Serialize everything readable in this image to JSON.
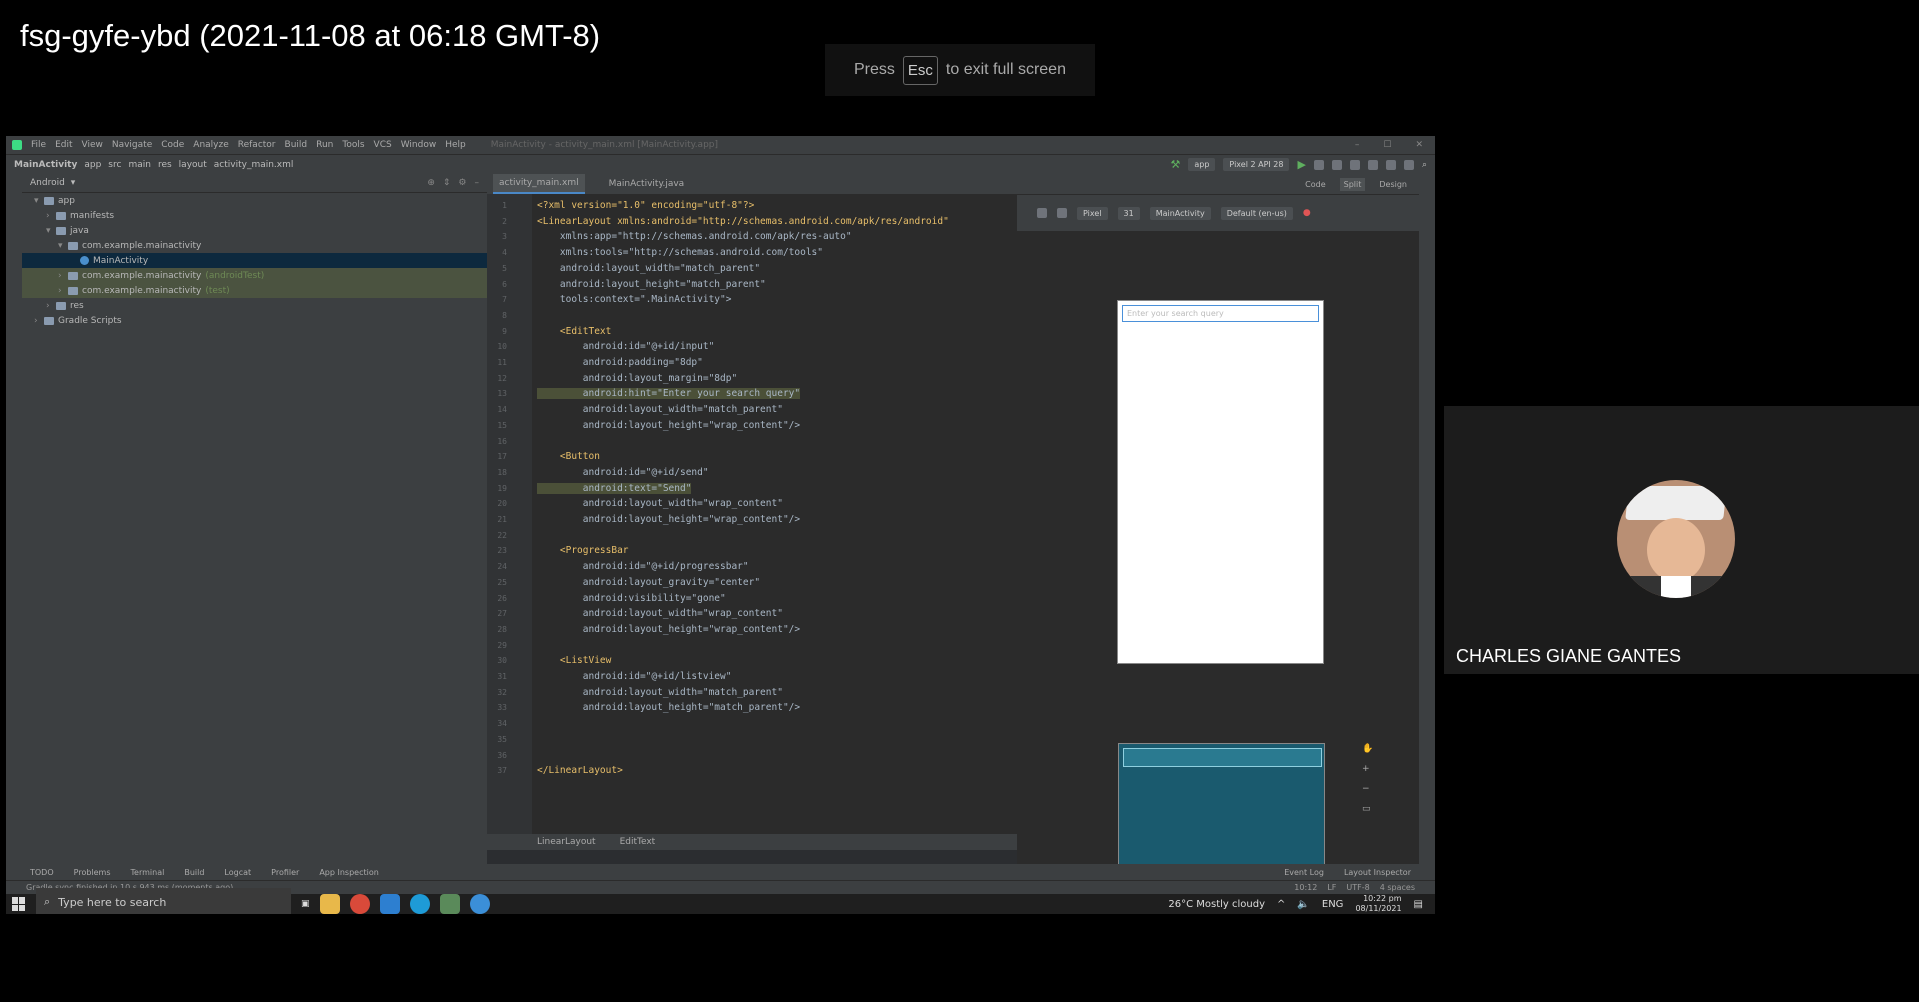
{
  "meeting": {
    "title": "fsg-gyfe-ybd (2021-11-08 at 06:18 GMT-8)",
    "esc_hint_press": "Press",
    "esc_key": "Esc",
    "esc_hint_rest": "to exit full screen"
  },
  "ide": {
    "menu": [
      "File",
      "Edit",
      "View",
      "Navigate",
      "Code",
      "Analyze",
      "Refactor",
      "Build",
      "Run",
      "Tools",
      "VCS",
      "Window",
      "Help"
    ],
    "window_title": "MainActivity - activity_main.xml [MainActivity.app]",
    "breadcrumbs": [
      "MainActivity",
      "app",
      "src",
      "main",
      "res",
      "layout",
      "activity_main.xml"
    ],
    "run_config": "app",
    "device": "Pixel 2 API 28",
    "project_view": "Android",
    "tree": [
      {
        "label": "app",
        "indent": 1,
        "arrow": "▾",
        "suffix": ""
      },
      {
        "label": "manifests",
        "indent": 2,
        "arrow": "›",
        "suffix": ""
      },
      {
        "label": "java",
        "indent": 2,
        "arrow": "▾",
        "suffix": ""
      },
      {
        "label": "com.example.mainactivity",
        "indent": 3,
        "arrow": "▾",
        "suffix": ""
      },
      {
        "label": "MainActivity",
        "indent": 4,
        "arrow": "",
        "suffix": ""
      },
      {
        "label": "com.example.mainactivity",
        "indent": 3,
        "arrow": "›",
        "suffix": "(androidTest)"
      },
      {
        "label": "com.example.mainactivity",
        "indent": 3,
        "arrow": "›",
        "suffix": "(test)"
      },
      {
        "label": "res",
        "indent": 2,
        "arrow": "›",
        "suffix": ""
      },
      {
        "label": "Gradle Scripts",
        "indent": 1,
        "arrow": "›",
        "suffix": ""
      }
    ],
    "tabs": [
      "activity_main.xml",
      "MainActivity.java"
    ],
    "code_lines": [
      "<?xml version=\"1.0\" encoding=\"utf-8\"?>",
      "<LinearLayout xmlns:android=\"http://schemas.android.com/apk/res/android\"",
      "    xmlns:app=\"http://schemas.android.com/apk/res-auto\"",
      "    xmlns:tools=\"http://schemas.android.com/tools\"",
      "    android:layout_width=\"match_parent\"",
      "    android:layout_height=\"match_parent\"",
      "    tools:context=\".MainActivity\">",
      "",
      "    <EditText",
      "        android:id=\"@+id/input\"",
      "        android:padding=\"8dp\"",
      "        android:layout_margin=\"8dp\"",
      "        android:hint=\"Enter your search query\"",
      "        android:layout_width=\"match_parent\"",
      "        android:layout_height=\"wrap_content\"/>",
      "",
      "    <Button",
      "        android:id=\"@+id/send\"",
      "        android:text=\"Send\"",
      "        android:layout_width=\"wrap_content\"",
      "        android:layout_height=\"wrap_content\"/>",
      "",
      "    <ProgressBar",
      "        android:id=\"@+id/progressbar\"",
      "        android:layout_gravity=\"center\"",
      "        android:visibility=\"gone\"",
      "        android:layout_width=\"wrap_content\"",
      "        android:layout_height=\"wrap_content\"/>",
      "",
      "    <ListView",
      "        android:id=\"@+id/listview\"",
      "        android:layout_width=\"match_parent\"",
      "        android:layout_height=\"match_parent\"/>",
      "",
      "",
      "",
      "</LinearLayout>"
    ],
    "editor_breadcrumbs": [
      "LinearLayout",
      "EditText"
    ],
    "design_modes": [
      "Code",
      "Split",
      "Design"
    ],
    "design_toolbar": [
      "Pixel",
      "31",
      "MainActivity",
      "Default (en-us)"
    ],
    "preview_hint": "Enter your search query",
    "bottom_tools": [
      "TODO",
      "Problems",
      "Terminal",
      "Build",
      "Logcat",
      "Profiler",
      "App Inspection"
    ],
    "bottom_tools_right": [
      "Event Log",
      "Layout Inspector"
    ],
    "status_message": "Gradle sync finished in 10 s 943 ms (moments ago)",
    "status_right": [
      "10:12",
      "LF",
      "UTF-8",
      "4 spaces"
    ]
  },
  "taskbar": {
    "search_placeholder": "Type here to search",
    "weather": "26°C  Mostly cloudy",
    "lang": "ENG",
    "time": "10:22 pm",
    "date": "08/11/2021"
  },
  "participant": {
    "name": "CHARLES GIANE GANTES"
  },
  "colors": {
    "ide_bg": "#2b2b2b",
    "accent": "#4a88c7",
    "tag": "#e8bf6a",
    "string": "#6a8759"
  }
}
